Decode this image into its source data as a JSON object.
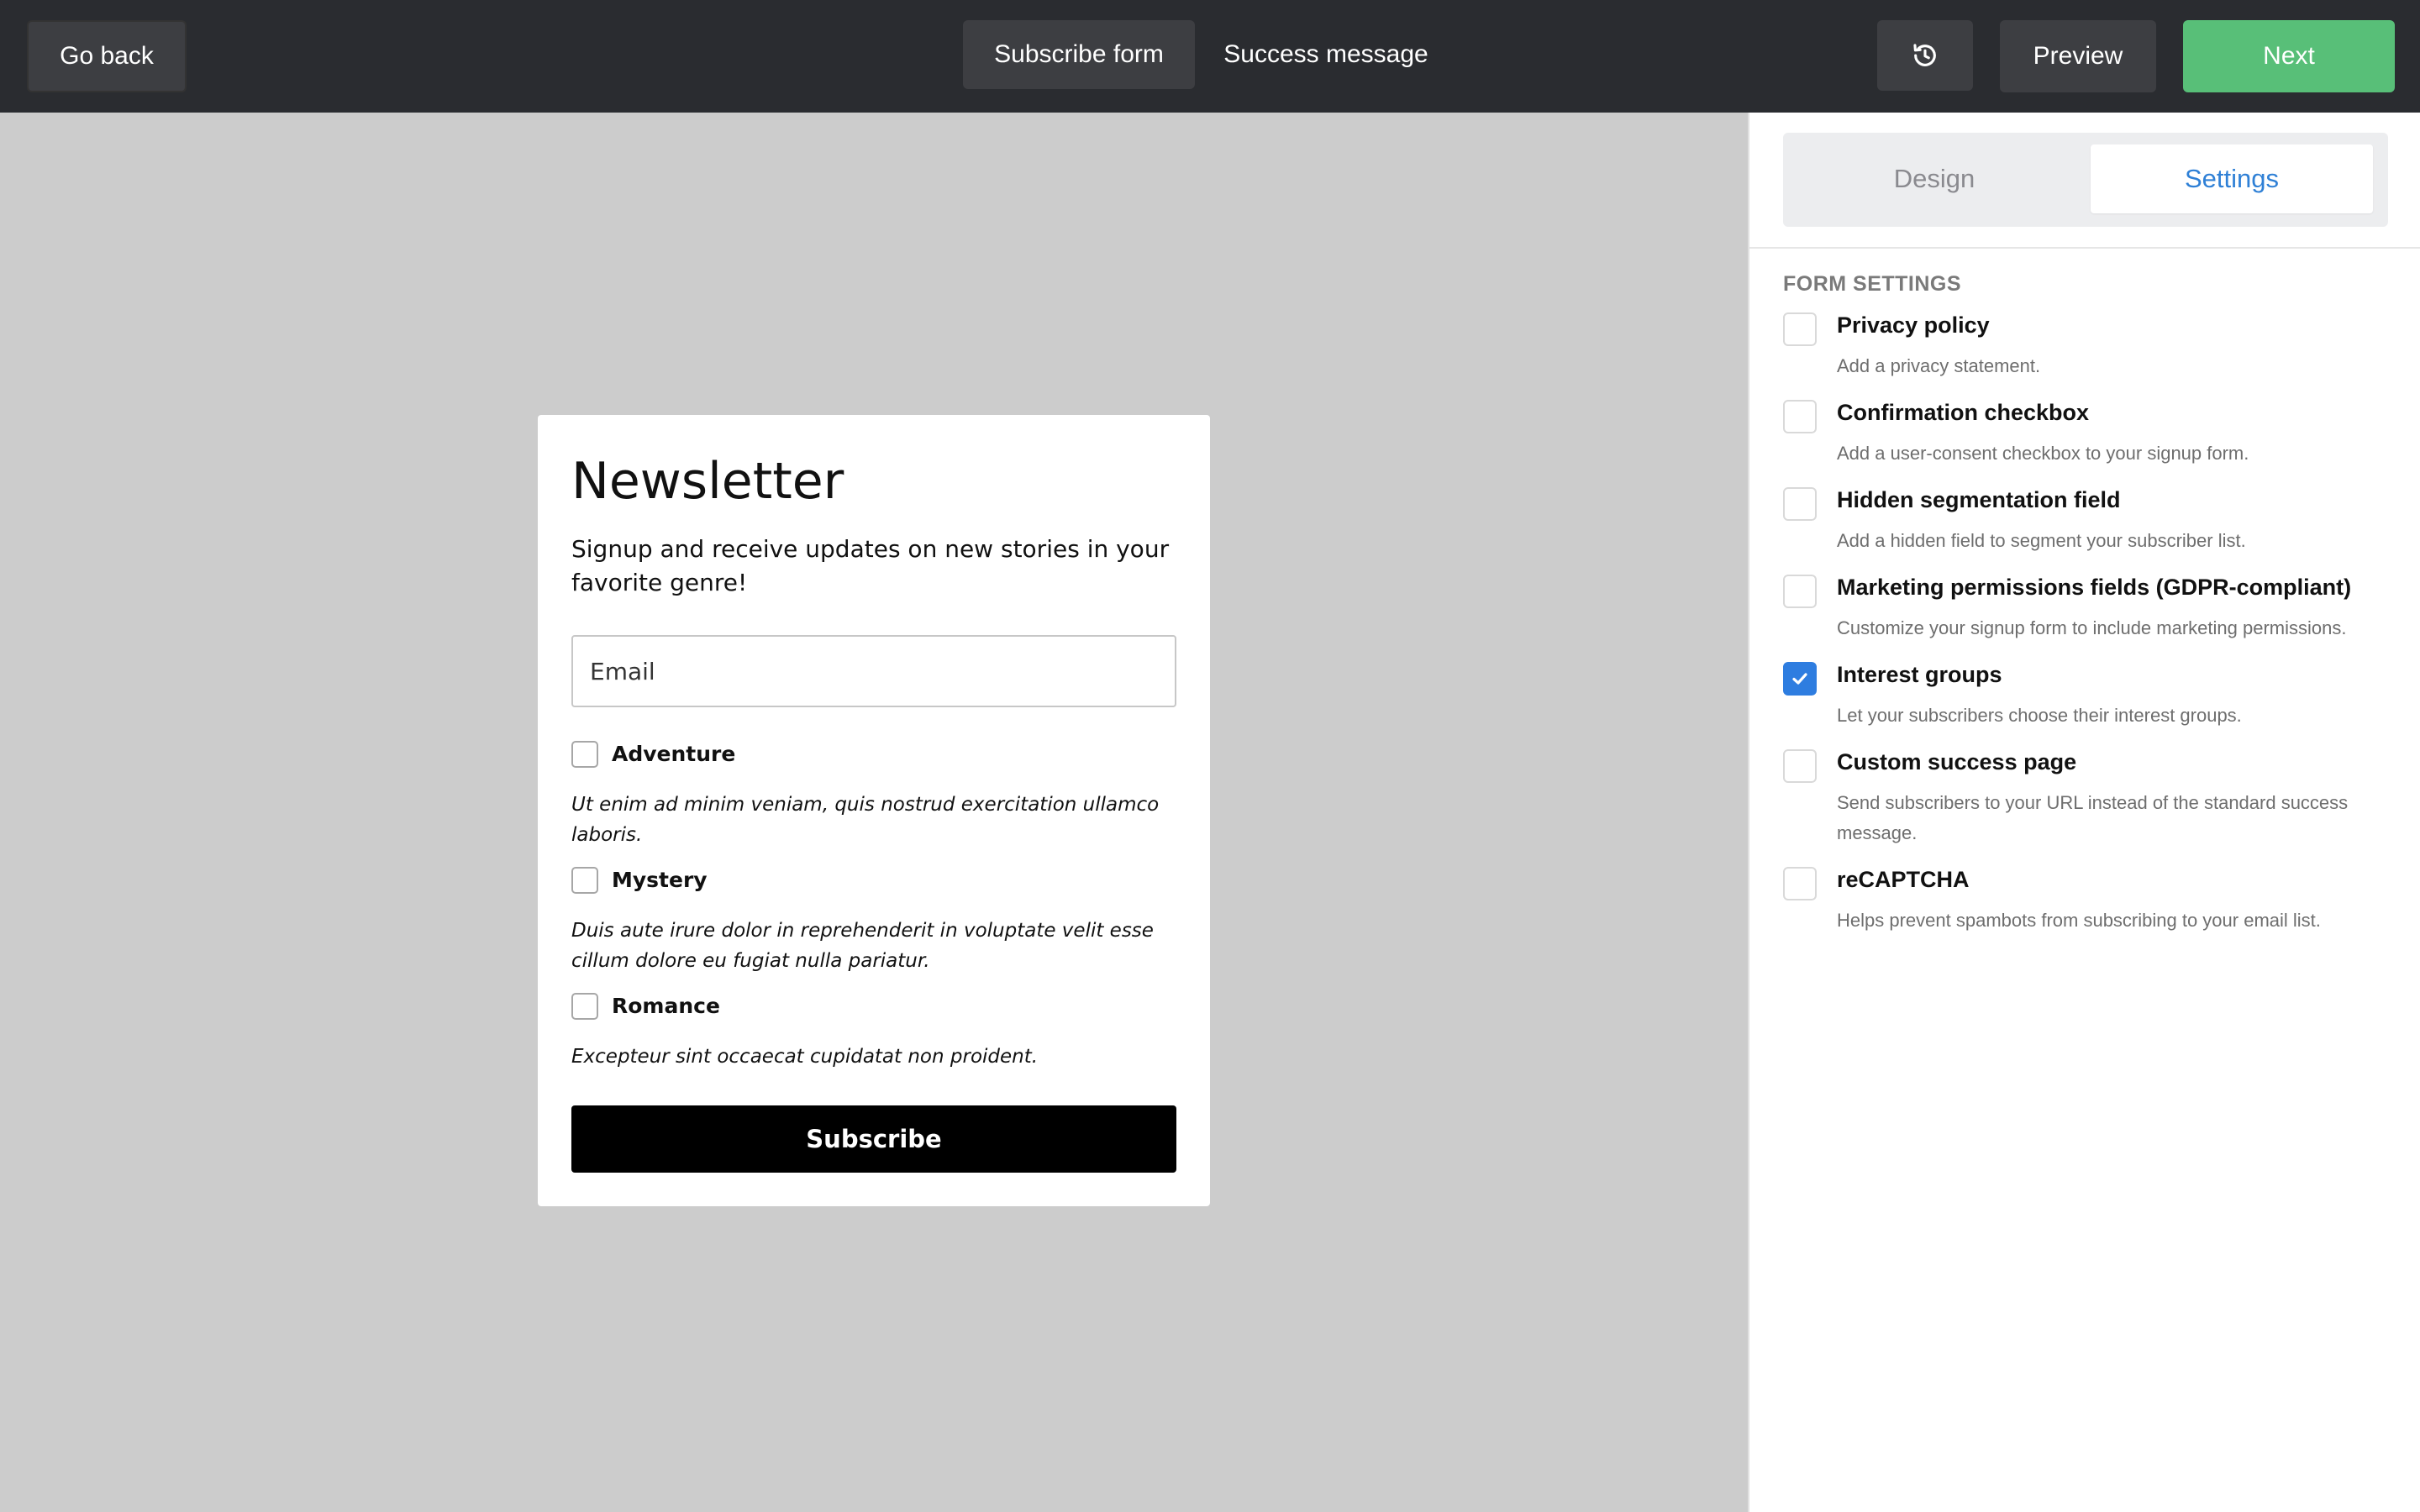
{
  "topbar": {
    "back_label": "Go back",
    "tabs": [
      {
        "label": "Subscribe form"
      },
      {
        "label": "Success message"
      }
    ],
    "preview_label": "Preview",
    "next_label": "Next",
    "history_icon": "history-icon",
    "colors": {
      "bar": "#2a2c30",
      "next": "#58bf78"
    }
  },
  "panel": {
    "tabs": [
      {
        "label": "Design"
      },
      {
        "label": "Settings"
      }
    ],
    "active_tab": "Settings",
    "section_title": "FORM SETTINGS",
    "settings": [
      {
        "label": "Privacy policy",
        "description": "Add a privacy statement.",
        "checked": false
      },
      {
        "label": "Confirmation checkbox",
        "description": "Add a user-consent checkbox to your signup form.",
        "checked": false
      },
      {
        "label": "Hidden segmentation field",
        "description": "Add a hidden field to segment your subscriber list.",
        "checked": false
      },
      {
        "label": "Marketing permissions fields (GDPR-compliant)",
        "description": "Customize your signup form to include marketing permissions.",
        "checked": false
      },
      {
        "label": "Interest groups",
        "description": "Let your subscribers choose their interest groups.",
        "checked": true
      },
      {
        "label": "Custom success page",
        "description": "Send subscribers to your URL instead of the standard success message.",
        "checked": false
      },
      {
        "label": "reCAPTCHA",
        "description": "Helps prevent spambots from subscribing to your email list.",
        "checked": false
      }
    ],
    "accent": "#2e7de0"
  },
  "form": {
    "title": "Newsletter",
    "subtitle": "Signup and receive updates on new stories in your favorite genre!",
    "email_placeholder": "Email",
    "genres": [
      {
        "label": "Adventure",
        "description": "Ut enim ad minim veniam, quis nostrud exercitation ullamco laboris."
      },
      {
        "label": "Mystery",
        "description": "Duis aute irure dolor in reprehenderit in voluptate velit esse cillum dolore eu fugiat nulla pariatur."
      },
      {
        "label": "Romance",
        "description": "Excepteur sint occaecat cupidatat non proident."
      }
    ],
    "subscribe_label": "Subscribe"
  }
}
